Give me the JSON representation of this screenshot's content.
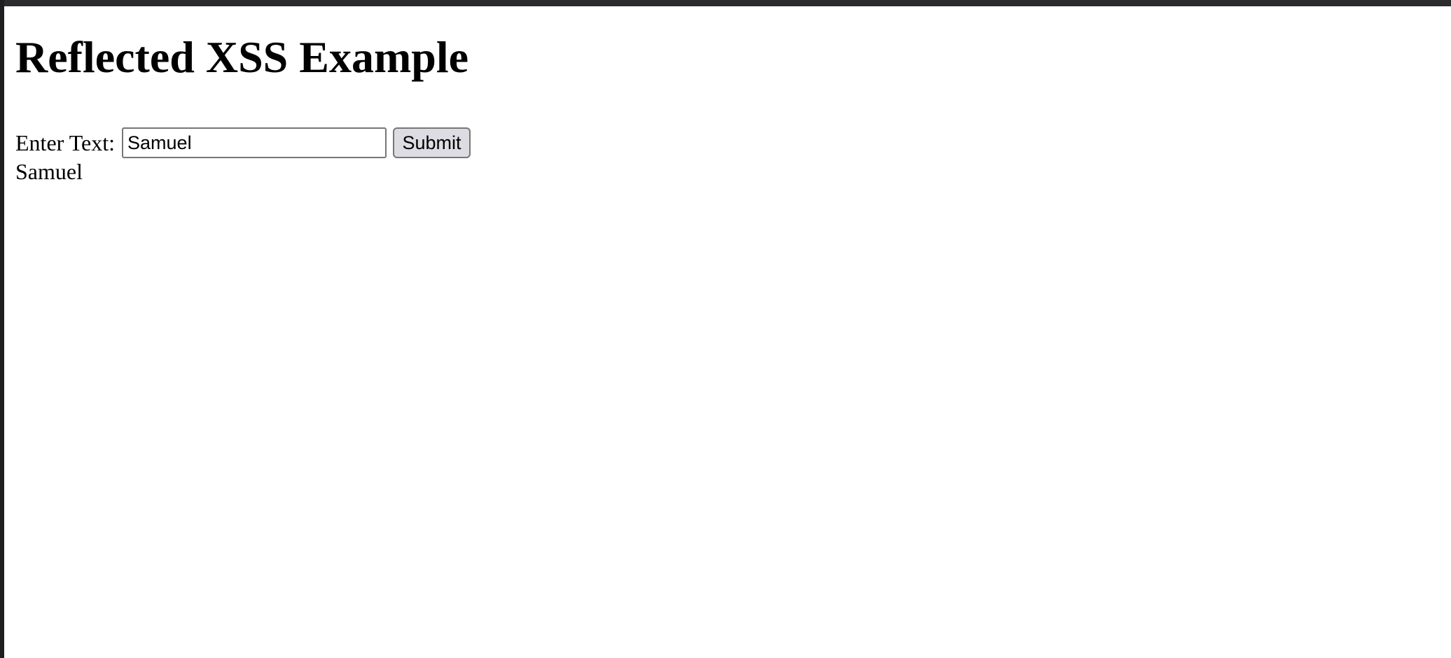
{
  "page": {
    "title": "Reflected XSS Example"
  },
  "form": {
    "label": "Enter Text:",
    "input_value": "Samuel",
    "submit_label": "Submit"
  },
  "output": {
    "reflected_text": "Samuel"
  },
  "colors": {
    "window_frame": "#2b2b2e",
    "button_background": "#dcdce2",
    "input_border": "#767676"
  }
}
